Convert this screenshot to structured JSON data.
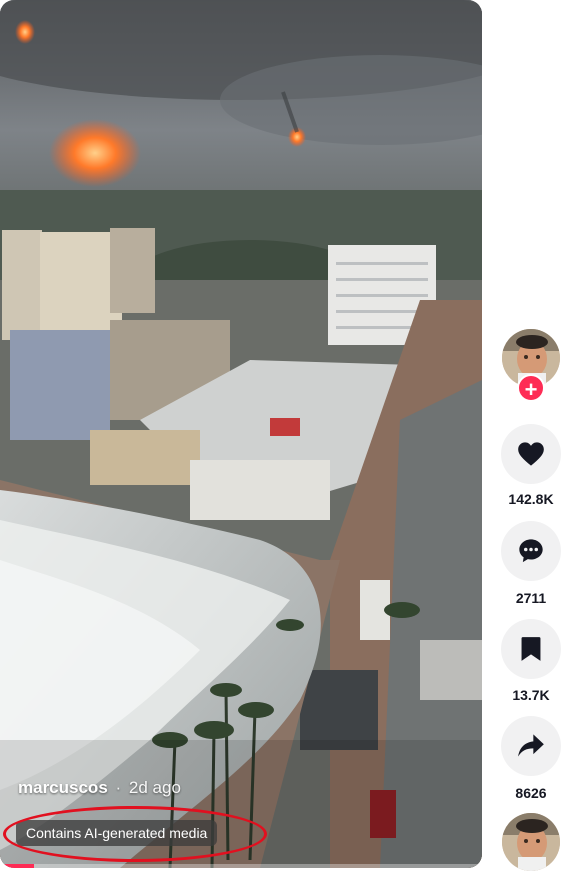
{
  "video": {
    "username": "marcuscos",
    "separator": "·",
    "posted": "2d ago",
    "ai_label": "Contains AI-generated media",
    "progress": 0.07
  },
  "actions": {
    "likes": "142.8K",
    "comments": "2711",
    "saves": "13.7K",
    "shares": "8626"
  },
  "icons": {
    "follow": "plus-icon",
    "like": "heart-icon",
    "comment": "comment-icon",
    "save": "bookmark-icon",
    "share": "share-arrow-icon"
  },
  "colors": {
    "accent": "#fe2c55",
    "annotation": "#e1101f",
    "count_text": "#161823",
    "button_bg": "#f1f1f2"
  }
}
